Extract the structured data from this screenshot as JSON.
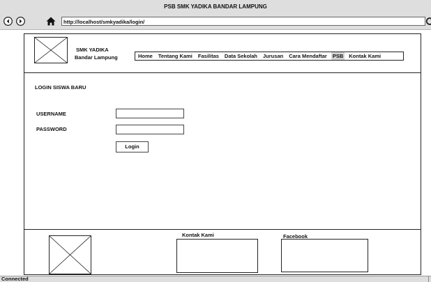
{
  "window": {
    "title": "PSB SMK YADIKA BANDAR LAMPUNG"
  },
  "toolbar": {
    "back_icon": "back-arrow-icon",
    "forward_icon": "forward-arrow-icon",
    "home_icon": "home-icon",
    "refresh_icon": "refresh-icon",
    "url": "http://localhost/smkyadika/login/"
  },
  "header": {
    "logo_icon": "image-placeholder-icon",
    "site_name_line1": "SMK YADIKA",
    "site_name_line2": "Bandar Lampung"
  },
  "menu": {
    "items": [
      {
        "label": "Home"
      },
      {
        "label": "Tentang Kami"
      },
      {
        "label": "Fasilitas"
      },
      {
        "label": "Data Sekolah"
      },
      {
        "label": "Jurusan"
      },
      {
        "label": "Cara Mendaftar"
      },
      {
        "label": "PSB"
      },
      {
        "label": "Kontak Kami"
      }
    ],
    "active_item": "PSB",
    "active_color": "#d4d4d4"
  },
  "login": {
    "title": "LOGIN SISWA BARU",
    "username_label": "USERNAME",
    "username_value": "",
    "password_label": "PASSWORD",
    "password_value": "",
    "button_label": "Login"
  },
  "footer": {
    "image_icon": "image-placeholder-icon",
    "contact_label": "Kontak Kami",
    "facebook_label": "Facebook"
  },
  "status": {
    "text": "Connected"
  }
}
